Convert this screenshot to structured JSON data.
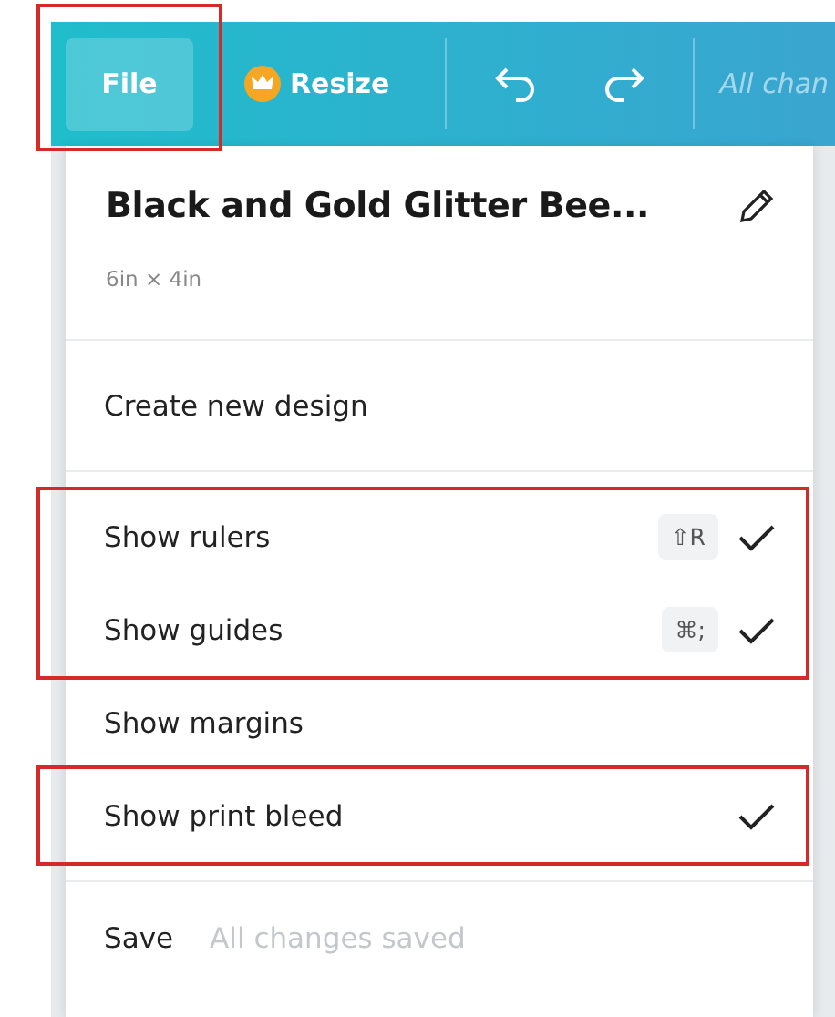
{
  "toolbar": {
    "file_button": {
      "label": "File",
      "highlighted": true
    },
    "resize_button": {
      "label": "Resize"
    },
    "status": "All chan"
  },
  "menu": {
    "title": "Black and Gold Glitter Bee...",
    "size": "6in × 4in",
    "sections": [
      [
        {
          "label": "Create new design",
          "checked": false,
          "highlighted": false
        }
      ],
      [
        {
          "label": "Show rulers",
          "shortcut": "⇧R",
          "checked": true,
          "highlighted": true
        },
        {
          "label": "Show guides",
          "shortcut": "⌘;",
          "checked": true,
          "highlighted": true
        },
        {
          "label": "Show margins",
          "checked": false,
          "highlighted": false
        },
        {
          "label": "Show print bleed",
          "checked": true,
          "highlighted": true
        }
      ]
    ],
    "save": {
      "label": "Save",
      "note": "All changes saved"
    }
  }
}
